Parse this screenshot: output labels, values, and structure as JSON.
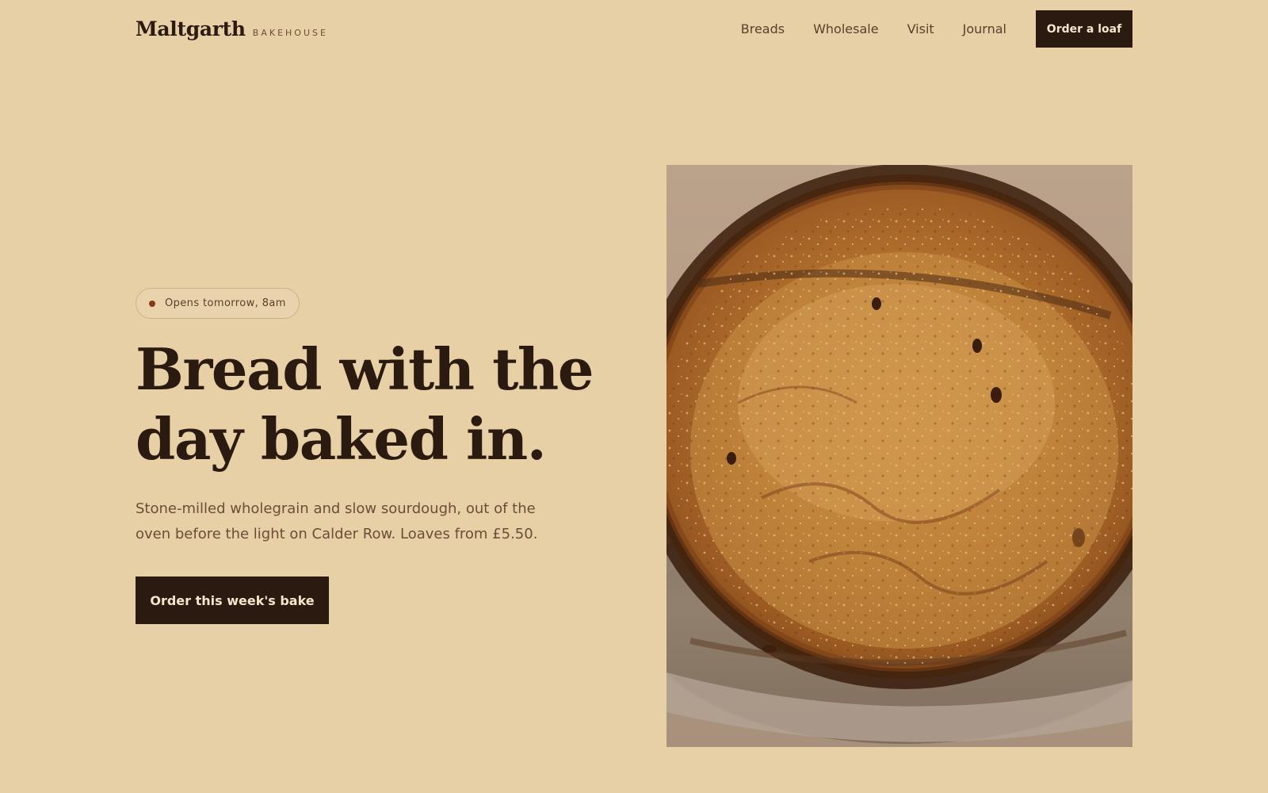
{
  "brand": {
    "name": "Maltgarth",
    "tagline": "BAKEHOUSE"
  },
  "nav": {
    "links": [
      {
        "label": "Breads"
      },
      {
        "label": "Wholesale"
      },
      {
        "label": "Visit"
      },
      {
        "label": "Journal"
      }
    ],
    "cta_label": "Order a loaf"
  },
  "hero": {
    "status": "Opens tomorrow, 8am",
    "headline_line1": "Bread with the",
    "headline_line2": "day baked in.",
    "description": "Stone-milled wholegrain and slow sourdough, out of the oven before the light on Calder Row. Loaves from £5.50.",
    "cta_label": "Order this week's bake",
    "image": "sourdough-loaf-photo"
  },
  "colors": {
    "background": "#e7cfa6",
    "ink": "#2b1a10",
    "muted_text": "#6b4e37",
    "accent_dot": "#8b3a12",
    "button_text": "#f4e6cc"
  }
}
